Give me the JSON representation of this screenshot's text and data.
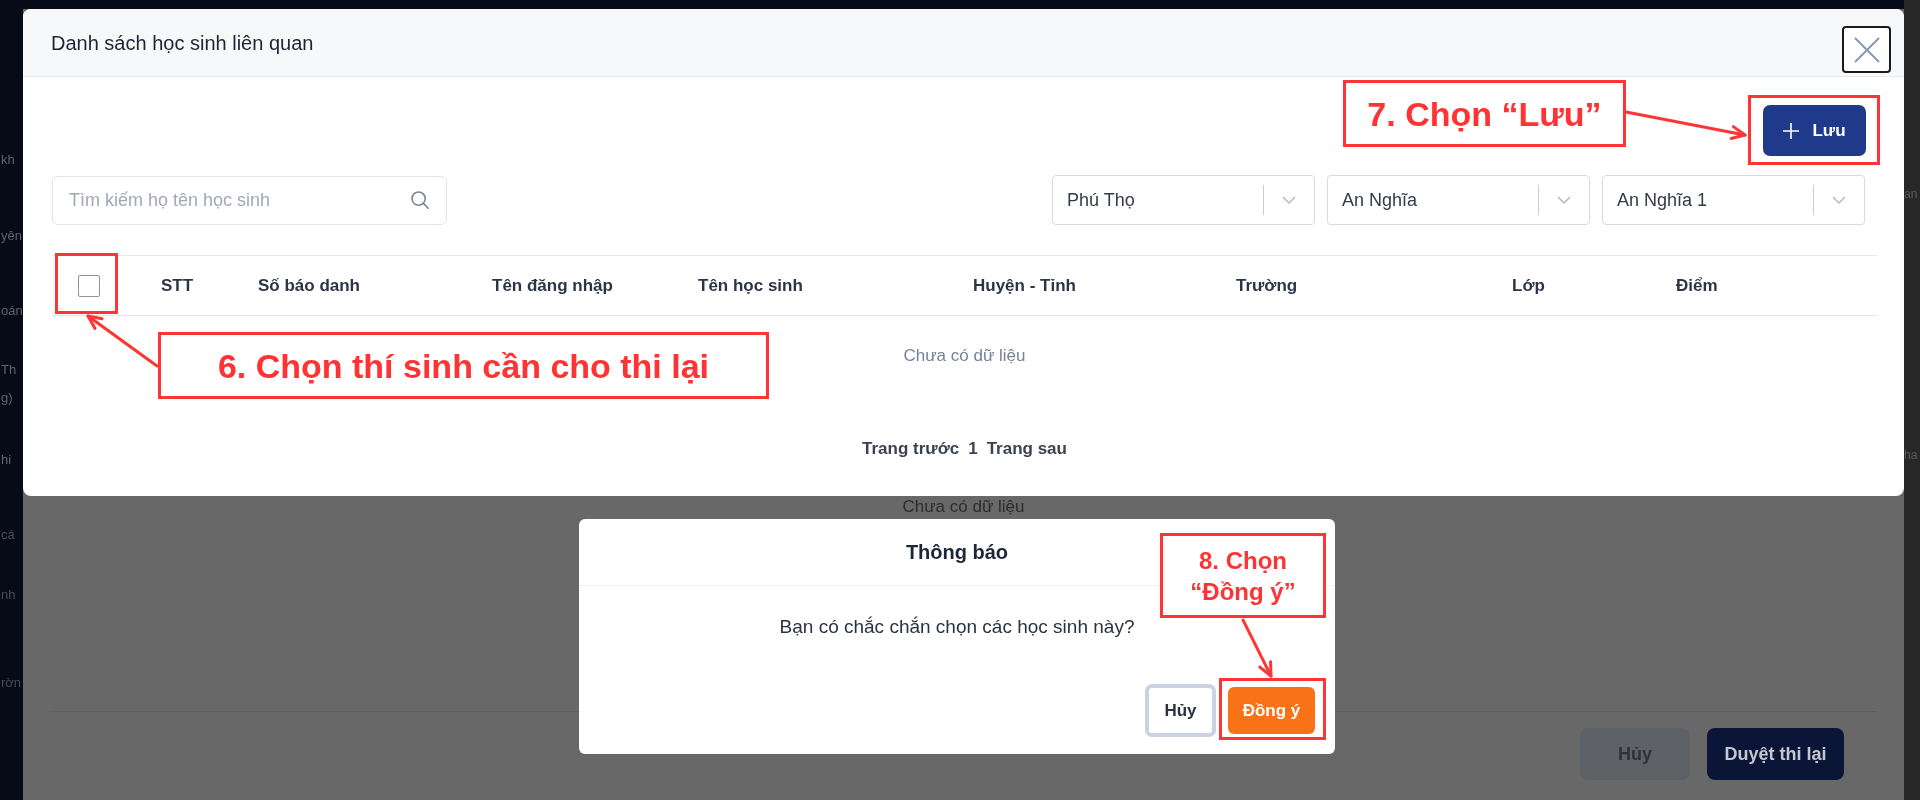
{
  "background": {
    "sidebar_items": [
      "kh",
      "yên",
      "oán",
      "Th",
      "g)",
      "hi",
      "cá",
      "nh",
      "rờn"
    ],
    "edge_texts": [
      "an",
      "ha"
    ],
    "dialog": {
      "empty_text": "Chưa có dữ liệu",
      "buttons": [
        {
          "label": "Hủy",
          "kind": "secondary"
        },
        {
          "label": "Duyệt thi lại",
          "kind": "primary"
        }
      ]
    }
  },
  "modal": {
    "title": "Danh sách học sinh liên quan",
    "save_button": {
      "label": "Lưu",
      "callout": "7. Chọn “Lưu”"
    },
    "search": {
      "placeholder": "Tìm kiếm họ tên học sinh"
    },
    "filters": [
      {
        "value": "Phú Thọ"
      },
      {
        "value": "An Nghĩa"
      },
      {
        "value": "An Nghĩa 1"
      }
    ],
    "table": {
      "select_all": {
        "checked": false,
        "callout": "6. Chọn thí sinh cần cho thi lại"
      },
      "columns": [
        "STT",
        "Số báo danh",
        "Tên đăng nhập",
        "Tên học sinh",
        "Huyện - Tỉnh",
        "Trường",
        "Lớp",
        "Điểm"
      ],
      "empty_text": "Chưa có dữ liệu"
    },
    "pagination": {
      "previous": "Trang trước",
      "page": "1",
      "next": "Trang sau"
    }
  },
  "confirm_dialog": {
    "title": "Thông báo",
    "message": "Bạn có chắc chắn chọn các học sinh này?",
    "buttons": [
      {
        "label": "Hủy",
        "kind": "secondary"
      },
      {
        "label": "Đồng ý",
        "kind": "primary",
        "callout": "8. Chọn “Đồng ý”"
      }
    ]
  }
}
